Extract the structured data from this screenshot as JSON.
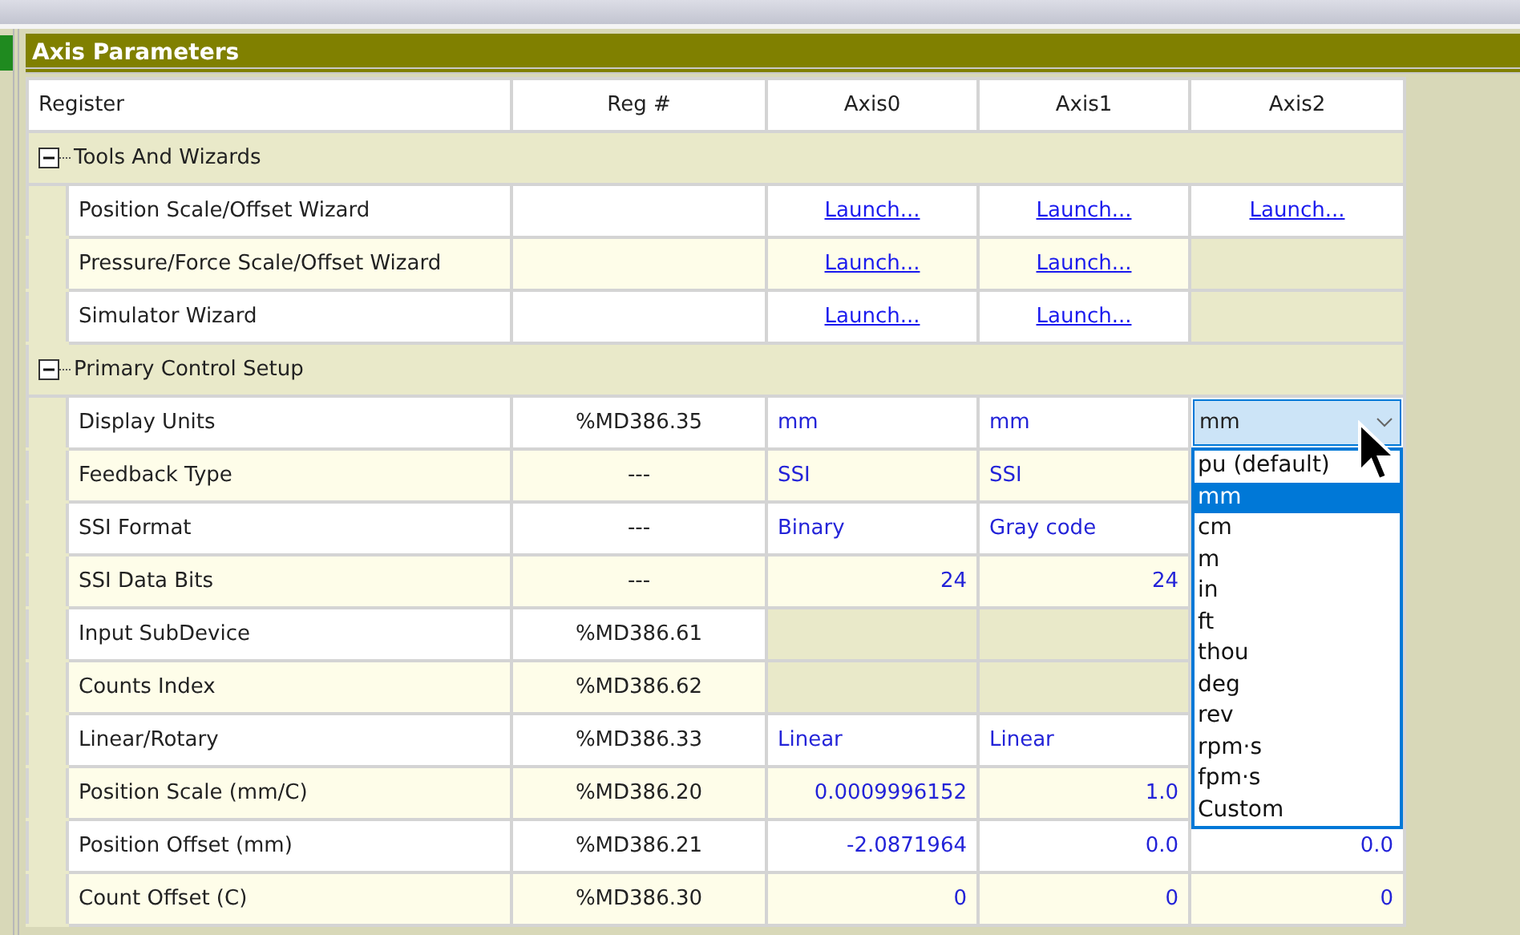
{
  "panel": {
    "title": "Axis Parameters"
  },
  "table": {
    "columns": [
      "Register",
      "Reg #",
      "Axis0",
      "Axis1",
      "Axis2"
    ],
    "groups": [
      {
        "title": "Tools And Wizards",
        "expanded": true,
        "rows": [
          {
            "register": "Position Scale/Offset Wizard",
            "cells": [
              {
                "kind": "link",
                "text": "Launch..."
              },
              {
                "kind": "link",
                "text": "Launch..."
              },
              {
                "kind": "link",
                "text": "Launch..."
              }
            ]
          },
          {
            "register": "Pressure/Force Scale/Offset Wizard",
            "cells": [
              {
                "kind": "link",
                "text": "Launch..."
              },
              {
                "kind": "link",
                "text": "Launch..."
              },
              {
                "kind": "disabled"
              }
            ]
          },
          {
            "register": "Simulator Wizard",
            "cells": [
              {
                "kind": "link",
                "text": "Launch..."
              },
              {
                "kind": "link",
                "text": "Launch..."
              },
              {
                "kind": "disabled"
              }
            ]
          }
        ]
      },
      {
        "title": "Primary Control Setup",
        "expanded": true,
        "rows": [
          {
            "register": "Display Units",
            "reg": "%MD386.35",
            "cells": [
              {
                "kind": "text",
                "text": "mm"
              },
              {
                "kind": "text",
                "text": "mm"
              },
              {
                "kind": "dropdown",
                "value": "mm",
                "open": true,
                "options": [
                  {
                    "label": "pu (default)",
                    "selected": false
                  },
                  {
                    "label": "mm",
                    "selected": true
                  },
                  {
                    "label": "cm",
                    "selected": false
                  },
                  {
                    "label": "m",
                    "selected": false
                  },
                  {
                    "label": "in",
                    "selected": false
                  },
                  {
                    "label": "ft",
                    "selected": false
                  },
                  {
                    "label": "thou",
                    "selected": false
                  },
                  {
                    "label": "deg",
                    "selected": false
                  },
                  {
                    "label": "rev",
                    "selected": false
                  },
                  {
                    "label": "rpm·s",
                    "selected": false
                  },
                  {
                    "label": "fpm·s",
                    "selected": false
                  },
                  {
                    "label": "Custom",
                    "selected": false
                  }
                ]
              }
            ]
          },
          {
            "register": "Feedback Type",
            "reg": "---",
            "cells": [
              {
                "kind": "text",
                "text": "SSI"
              },
              {
                "kind": "text",
                "text": "SSI"
              }
            ]
          },
          {
            "register": "SSI Format",
            "reg": "---",
            "cells": [
              {
                "kind": "text",
                "text": "Binary"
              },
              {
                "kind": "text",
                "text": "Gray code"
              }
            ]
          },
          {
            "register": "SSI Data Bits",
            "reg": "---",
            "cells": [
              {
                "kind": "number",
                "text": "24"
              },
              {
                "kind": "number",
                "text": "24"
              }
            ]
          },
          {
            "register": "Input SubDevice",
            "reg": "%MD386.61",
            "cells": [
              {
                "kind": "disabled"
              },
              {
                "kind": "disabled"
              }
            ]
          },
          {
            "register": "Counts Index",
            "reg": "%MD386.62",
            "cells": [
              {
                "kind": "disabled"
              },
              {
                "kind": "disabled"
              }
            ]
          },
          {
            "register": "Linear/Rotary",
            "reg": "%MD386.33",
            "cells": [
              {
                "kind": "text",
                "text": "Linear"
              },
              {
                "kind": "text",
                "text": "Linear"
              }
            ]
          },
          {
            "register": "Position Scale (mm/C)",
            "reg": "%MD386.20",
            "cells": [
              {
                "kind": "number",
                "text": "0.0009996152"
              },
              {
                "kind": "number",
                "text": "1.0"
              }
            ]
          },
          {
            "register": "Position Offset (mm)",
            "reg": "%MD386.21",
            "cells": [
              {
                "kind": "number",
                "text": "-2.0871964"
              },
              {
                "kind": "number",
                "text": "0.0"
              },
              {
                "kind": "number",
                "text": "0.0"
              }
            ]
          },
          {
            "register": "Count Offset (C)",
            "reg": "%MD386.30",
            "cells": [
              {
                "kind": "number",
                "text": "0"
              },
              {
                "kind": "number",
                "text": "0"
              },
              {
                "kind": "number",
                "text": "0"
              }
            ]
          }
        ]
      }
    ]
  }
}
